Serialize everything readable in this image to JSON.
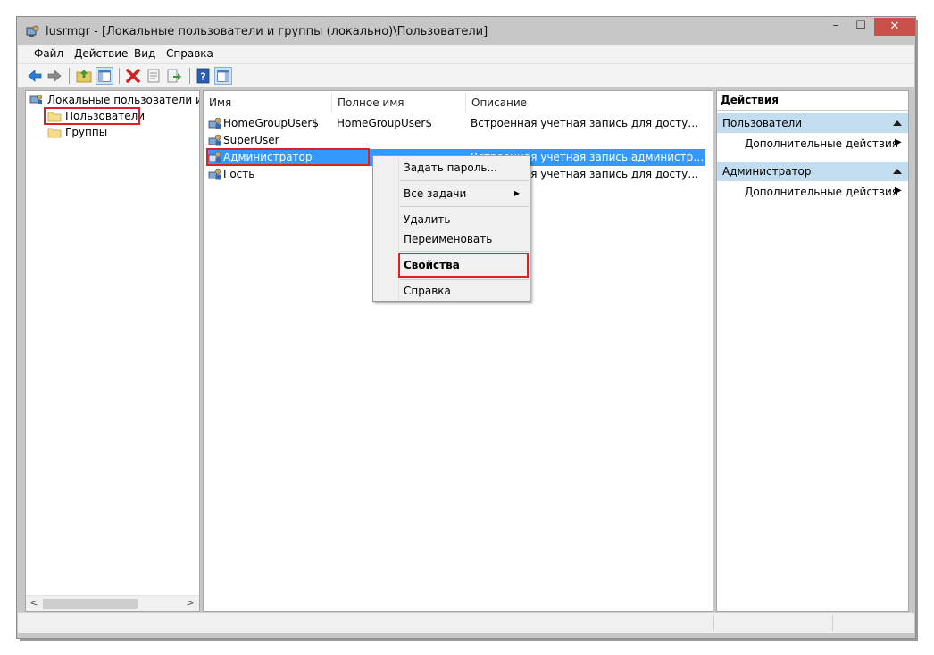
{
  "window": {
    "title": "lusrmgr - [Локальные пользователи и группы (локально)\\Пользователи]",
    "minimize_glyph": "–",
    "maximize_glyph": "☐",
    "close_glyph": "✕"
  },
  "menu": [
    "Файл",
    "Действие",
    "Вид",
    "Справка"
  ],
  "toolbar": [
    "back-arrow-icon",
    "forward-arrow-icon",
    "up-folder-icon",
    "show-hide-tree-icon",
    "delete-icon",
    "properties-icon",
    "export-list-icon",
    "help-icon",
    "show-hide-actions-icon"
  ],
  "tree": {
    "root": "Локальные пользователи и группы (локально)",
    "items": [
      "Пользователи",
      "Группы"
    ],
    "scroll_left": "<",
    "scroll_right": ">"
  },
  "list": {
    "columns": [
      "Имя",
      "Полное имя",
      "Описание"
    ],
    "rows": [
      {
        "name": "HomeGroupUser$",
        "full_name": "HomeGroupUser$",
        "description": "Встроенная учетная запись для доступа из д..."
      },
      {
        "name": "SuperUser",
        "full_name": "",
        "description": ""
      },
      {
        "name": "Администратор",
        "full_name": "",
        "description": "Встроенная учетная запись администратора..."
      },
      {
        "name": "Гость",
        "full_name": "",
        "description": "Встроенная учетная запись для доступа гост..."
      }
    ]
  },
  "context_menu": {
    "set_password": "Задать пароль...",
    "all_tasks": "Все задачи",
    "submenu_arrow": "▸",
    "delete": "Удалить",
    "rename": "Переименовать",
    "properties": "Свойства",
    "help": "Справка"
  },
  "actions": {
    "header": "Действия",
    "groups": [
      {
        "title": "Пользователи",
        "item": "Дополнительные действия"
      },
      {
        "title": "Администратор",
        "item": "Дополнительные действия"
      }
    ],
    "arrow": "▶"
  },
  "colors": {
    "selection": "#3399ff",
    "highlight_box": "#e02020",
    "close_button": "#c7504a",
    "action_group": "#c2dcf0"
  }
}
